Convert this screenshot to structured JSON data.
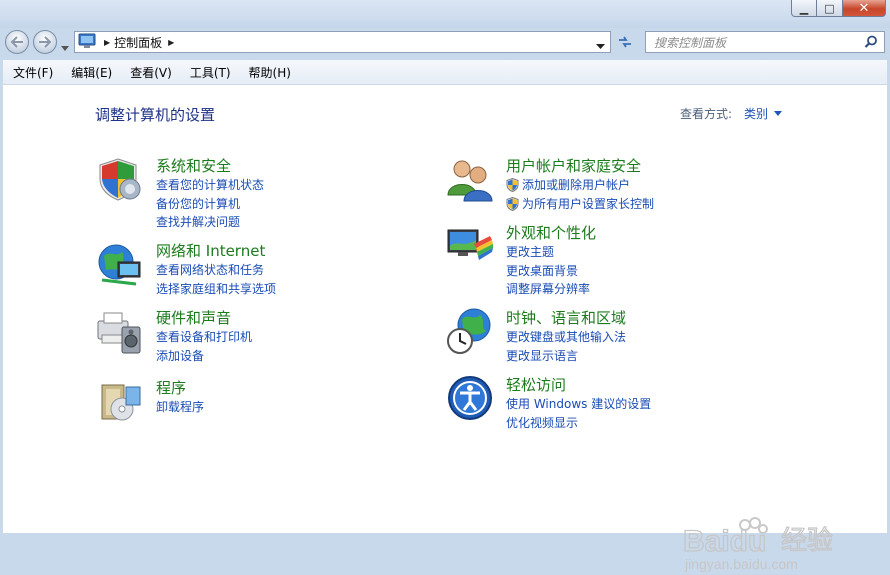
{
  "window": {
    "caption": {
      "minimize": "▁",
      "maximize": "□",
      "close": "✕"
    }
  },
  "address": {
    "segment": "控制面板",
    "icon": "control-panel-icon"
  },
  "search": {
    "placeholder": "搜索控制面板",
    "icon": "search-icon"
  },
  "menu": {
    "items": [
      "文件(F)",
      "编辑(E)",
      "查看(V)",
      "工具(T)",
      "帮助(H)"
    ]
  },
  "page": {
    "title": "调整计算机的设置",
    "view_by_label": "查看方式:",
    "view_by_value": "类别"
  },
  "categories": [
    {
      "title": "系统和安全",
      "icon": "shield-icon",
      "links": [
        "查看您的计算机状态",
        "备份您的计算机",
        "查找并解决问题"
      ]
    },
    {
      "title": "网络和 Internet",
      "icon": "network-globe-icon",
      "links": [
        "查看网络状态和任务",
        "选择家庭组和共享选项"
      ]
    },
    {
      "title": "硬件和声音",
      "icon": "printer-speaker-icon",
      "links": [
        "查看设备和打印机",
        "添加设备"
      ]
    },
    {
      "title": "程序",
      "icon": "programs-box-icon",
      "links": [
        "卸载程序"
      ]
    },
    {
      "title": "用户帐户和家庭安全",
      "icon": "users-icon",
      "links": [
        "添加或删除用户帐户",
        "为所有用户设置家长控制"
      ]
    },
    {
      "title": "外观和个性化",
      "icon": "monitor-palette-icon",
      "links": [
        "更改主题",
        "更改桌面背景",
        "调整屏幕分辨率"
      ]
    },
    {
      "title": "时钟、语言和区域",
      "icon": "clock-globe-icon",
      "links": [
        "更改键盘或其他输入法",
        "更改显示语言"
      ]
    },
    {
      "title": "轻松访问",
      "icon": "ease-of-access-icon",
      "links": [
        "使用 Windows 建议的设置",
        "优化视频显示"
      ]
    }
  ],
  "watermark": {
    "brand": "Baidu",
    "suffix": "经验",
    "url": "jingyan.baidu.com"
  }
}
